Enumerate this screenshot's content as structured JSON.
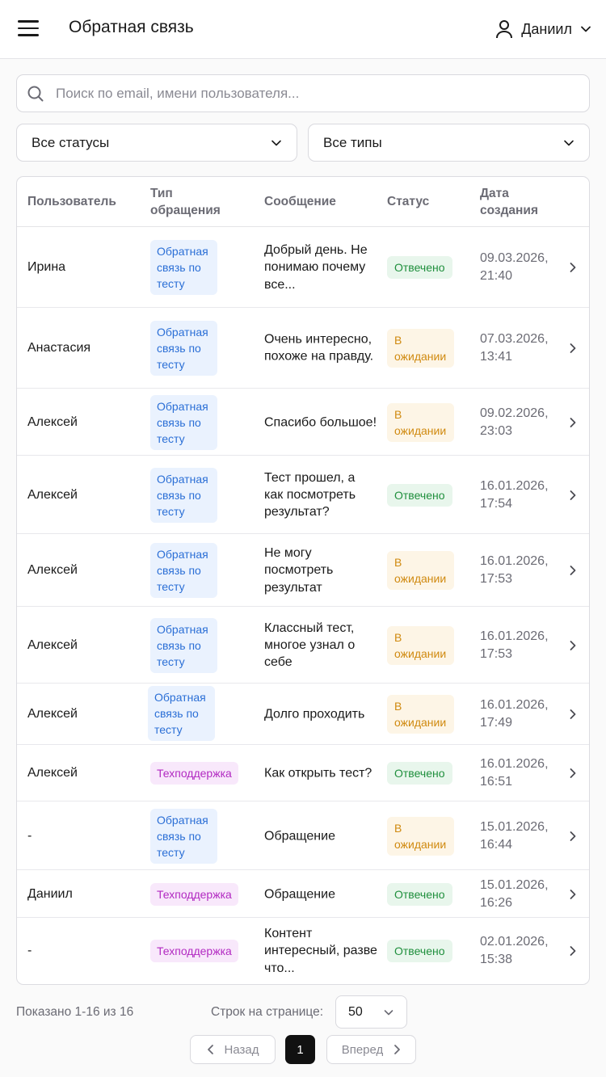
{
  "header": {
    "title": "Обратная связь",
    "user_name": "Даниил",
    "icons": {
      "menu": "hamburger-menu-icon",
      "user": "user-icon",
      "dropdown": "chevron-down-icon"
    }
  },
  "search": {
    "value": "",
    "placeholder": "Поиск по email, имени пользователя...",
    "icon": "search-icon"
  },
  "filters": {
    "status": {
      "selected": "Все статусы"
    },
    "type": {
      "selected": "Все типы"
    }
  },
  "table": {
    "columns": {
      "user": "Пользователь",
      "type_line1": "Тип",
      "type_line2": "обращения",
      "message": "Сообщение",
      "status": "Статус",
      "date_line1": "Дата",
      "date_line2": "создания"
    },
    "rows": [
      {
        "user": "Ирина",
        "type": "Обратная связь по тесту",
        "message": "Добрый день. Не понимаю почему все...",
        "status": "Отвечено",
        "date": "09.03.2026, 21:40"
      },
      {
        "user": "Анастасия",
        "type": "Обратная связь по тесту",
        "message": "Очень интересно, похоже на правду.",
        "status": "В ожидании",
        "date": "07.03.2026, 13:41"
      },
      {
        "user": "Алексей",
        "type": "Обратная связь по тесту",
        "message": "Спасибо большое!",
        "status": "В ожидании",
        "date": "09.02.2026, 23:03"
      },
      {
        "user": "Алексей",
        "type": "Обратная связь по тесту",
        "message": "Тест прошел, а как посмотреть результат?",
        "status": "Отвечено",
        "date": "16.01.2026, 17:54"
      },
      {
        "user": "Алексей",
        "type": "Обратная связь по тесту",
        "message": "Не могу посмотреть результат",
        "status": "В ожидании",
        "date": "16.01.2026, 17:53"
      },
      {
        "user": "Алексей",
        "type": "Обратная связь по тесту",
        "message": "Классный тест, многое узнал о себе",
        "status": "В ожидании",
        "date": "16.01.2026, 17:53"
      },
      {
        "user": "Алексей",
        "type": "Обратная связь по тесту",
        "message": "Долго проходить",
        "status": "В ожидании",
        "date": "16.01.2026, 17:49"
      },
      {
        "user": "Алексей",
        "type": "Техподдержка",
        "message": "Как открыть тест?",
        "status": "Отвечено",
        "date": "16.01.2026, 16:51"
      },
      {
        "user": "-",
        "type": "Обратная связь по тесту",
        "message": "Обращение",
        "status": "В ожидании",
        "date": "15.01.2026, 16:44"
      },
      {
        "user": "Даниил",
        "type": "Техподдержка",
        "message": "Обращение",
        "status": "Отвечено",
        "date": "15.01.2026, 16:26"
      },
      {
        "user": "-",
        "type": "Техподдержка",
        "message": "Контент интересный, разве что...",
        "status": "Отвечено",
        "date": "02.01.2026, 15:38"
      }
    ]
  },
  "footer": {
    "shown": "Показано 1-16 из 16",
    "rows_per_page_label": "Строк на странице:",
    "rows_per_page": "50",
    "prev": "Назад",
    "next": "Вперед",
    "current_page": "1"
  },
  "colors": {
    "answered_bg": "#e8f6ec",
    "answered_text": "#1f8f3d",
    "waiting_bg": "#fdf5e6",
    "waiting_text": "#d08a10",
    "feedback_bg": "#eaf2fe",
    "feedback_text": "#2b6fd6",
    "support_bg": "#f8e8fb",
    "support_text": "#b22ac2"
  }
}
